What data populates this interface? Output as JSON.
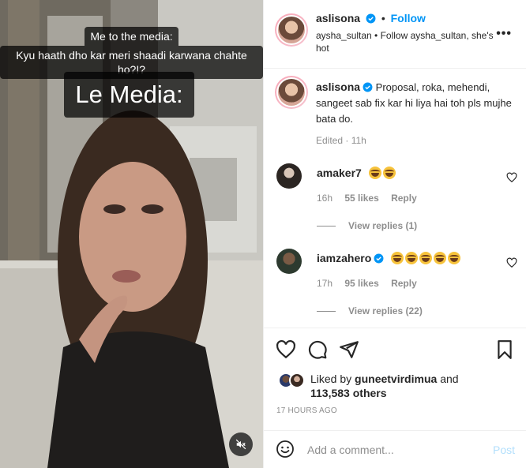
{
  "media": {
    "caption_line1": "Me to the media:",
    "caption_line2": "Kyu haath dho kar meri shaadi karwana chahte ho?!?",
    "caption_big": "Le Media:",
    "mute_icon": "speaker-muted-icon"
  },
  "header": {
    "username": "aslisona",
    "separator": "•",
    "follow_label": "Follow",
    "subline": "aysha_sultan • Follow aysha_sultan, she's hot",
    "more_icon": "more-horizontal-icon",
    "more_label": "•••"
  },
  "caption": {
    "username": "aslisona",
    "text": "Proposal, roka, mehendi, sangeet sab fix kar hi liya hai toh pls mujhe bata do.",
    "edited": "Edited · 11h"
  },
  "comments": [
    {
      "username": "amaker7",
      "emoji_count": 2,
      "time": "16h",
      "likes": "55 likes",
      "reply_label": "Reply",
      "view_replies": "View replies (1)"
    },
    {
      "username": "iamzahero",
      "emoji_count": 5,
      "time": "17h",
      "likes": "95 likes",
      "reply_label": "Reply",
      "view_replies": "View replies (22)"
    }
  ],
  "actions": {
    "like_icon": "heart-icon",
    "comment_icon": "comment-icon",
    "share_icon": "share-icon",
    "save_icon": "bookmark-icon"
  },
  "likes": {
    "prefix": "Liked by",
    "user": "guneetvirdimua",
    "and": "and",
    "others": "113,583 others"
  },
  "timestamp": "17 HOURS AGO",
  "add_comment": {
    "placeholder": "Add a comment...",
    "post_label": "Post",
    "emoji_icon": "smiley-icon"
  },
  "colors": {
    "accent": "#0095f6",
    "post_disabled": "#b2dffc",
    "muted_text": "#8e8e8e"
  }
}
